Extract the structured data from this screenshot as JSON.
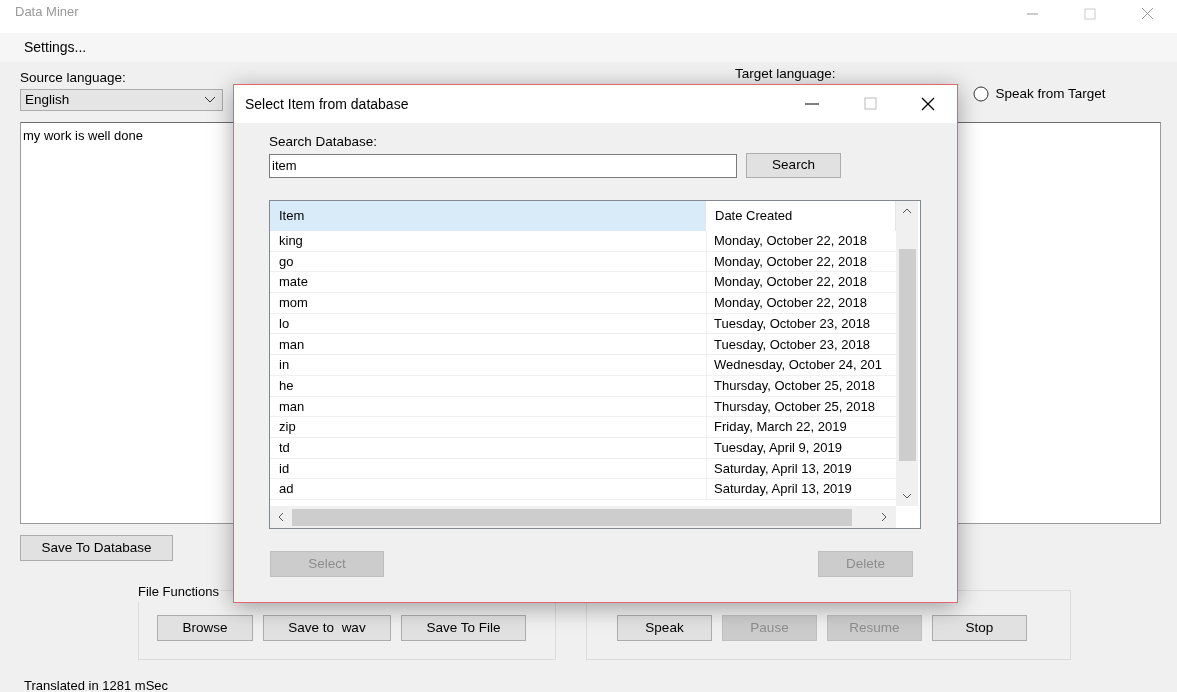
{
  "window": {
    "title": "Data Miner"
  },
  "menu": [
    {
      "label": "Settings..."
    }
  ],
  "source_language": {
    "label": "Source language:",
    "value": "English"
  },
  "target_language": {
    "label": "Target language:"
  },
  "speak_from_target": {
    "label": "Speak from Target",
    "selected": false
  },
  "source_text": "my work is well done",
  "save_button": "Save To Database",
  "file_functions": {
    "title": "File Functions",
    "buttons": [
      {
        "label": "Browse",
        "disabled": false
      },
      {
        "label": "Save to  wav",
        "disabled": false
      },
      {
        "label": "Save To File",
        "disabled": false
      }
    ]
  },
  "speech_buttons": [
    {
      "label": "Speak",
      "disabled": false
    },
    {
      "label": "Pause",
      "disabled": true
    },
    {
      "label": "Resume",
      "disabled": true
    },
    {
      "label": "Stop",
      "disabled": false
    }
  ],
  "status_bar": "Translated in 1281 mSec",
  "dialog": {
    "title": "Select Item from database",
    "search_label": "Search Database:",
    "search_value": "item",
    "search_button": "Search",
    "columns": [
      {
        "label": "Item",
        "highlighted": true
      },
      {
        "label": "Date Created",
        "highlighted": false
      }
    ],
    "rows": [
      {
        "item": "king",
        "date": "Monday, October 22, 2018"
      },
      {
        "item": "go",
        "date": "Monday, October 22, 2018"
      },
      {
        "item": "mate",
        "date": "Monday, October 22, 2018"
      },
      {
        "item": "mom",
        "date": "Monday, October 22, 2018"
      },
      {
        "item": "lo",
        "date": "Tuesday, October 23, 2018"
      },
      {
        "item": "man",
        "date": "Tuesday, October 23, 2018"
      },
      {
        "item": "in",
        "date": "Wednesday, October 24, 201"
      },
      {
        "item": "he",
        "date": "Thursday, October 25, 2018"
      },
      {
        "item": "man",
        "date": "Thursday, October 25, 2018"
      },
      {
        "item": "zip",
        "date": "Friday, March 22, 2019"
      },
      {
        "item": "td",
        "date": "Tuesday, April 9, 2019"
      },
      {
        "item": "id",
        "date": "Saturday, April 13, 2019"
      },
      {
        "item": "ad",
        "date": "Saturday, April 13, 2019"
      }
    ],
    "buttons": [
      {
        "label": "Select",
        "disabled": true
      },
      {
        "label": "Delete",
        "disabled": true
      }
    ]
  }
}
